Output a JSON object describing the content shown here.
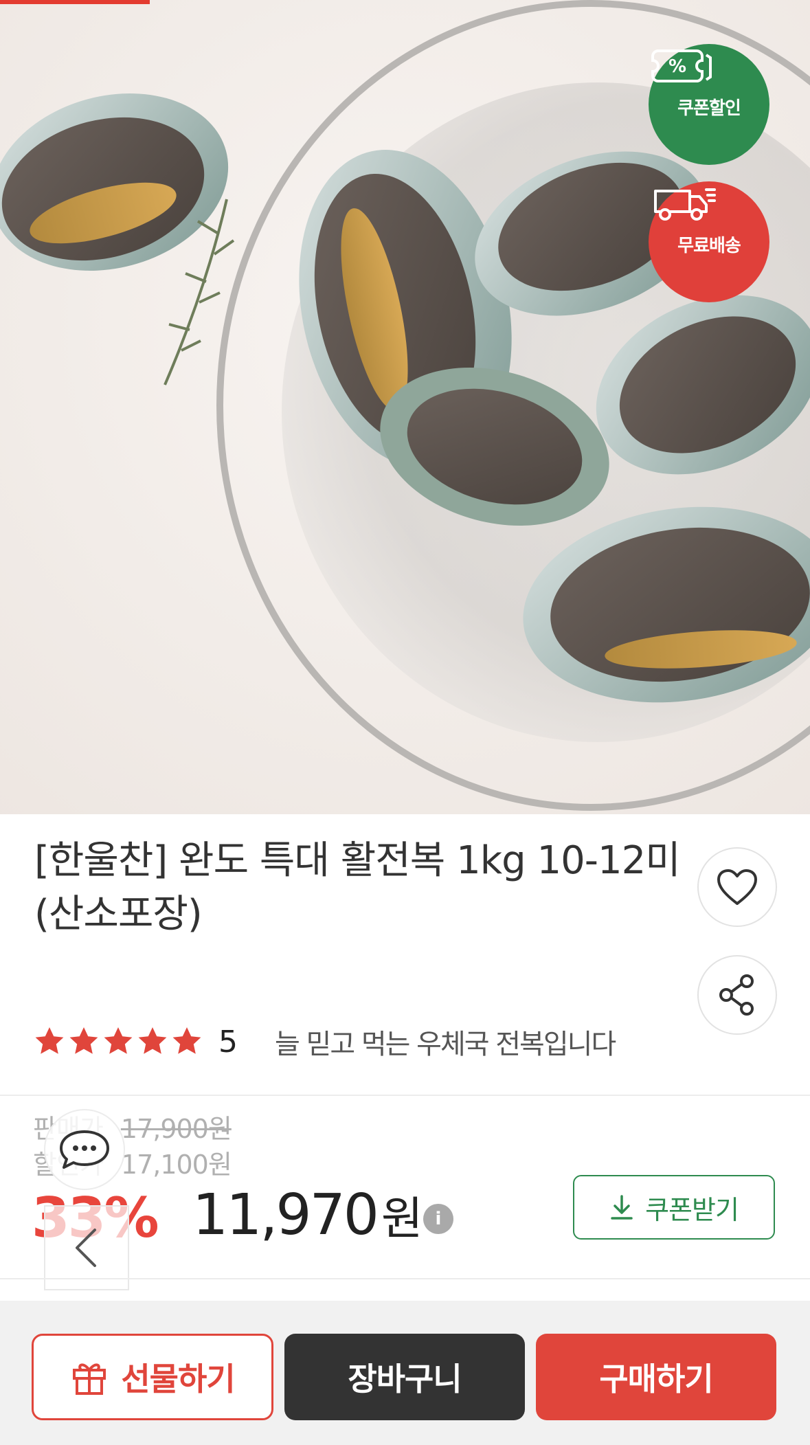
{
  "progress": {
    "fraction": 0.185,
    "color": "#e33b30"
  },
  "hero": {
    "badges": [
      {
        "icon": "coupon-percent-icon",
        "label": "쿠폰할인",
        "color": "#2e8b4f"
      },
      {
        "icon": "delivery-truck-icon",
        "label": "무료배송",
        "color": "#e0403a"
      }
    ]
  },
  "product": {
    "title": "[한울찬] 완도 특대 활전복 1kg 10-12미 (산소포장)",
    "rating": {
      "stars": 5,
      "value": "5"
    },
    "tagline": "늘 믿고 먹는 우체국 전복입니다"
  },
  "price": {
    "sale_label": "판매가",
    "sale_price": "17,900원",
    "discount_label": "할인가",
    "discount_price": "17,100원",
    "discount_rate": "33%",
    "final_price": "11,970",
    "final_unit": "원",
    "info_icon": "i",
    "coupon_button": "쿠폰받기"
  },
  "actions": {
    "gift": "선물하기",
    "cart": "장바구니",
    "buy": "구매하기"
  },
  "colors": {
    "accent_red": "#e0453b",
    "accent_green": "#2e8b4f",
    "dark_button": "#333333"
  }
}
